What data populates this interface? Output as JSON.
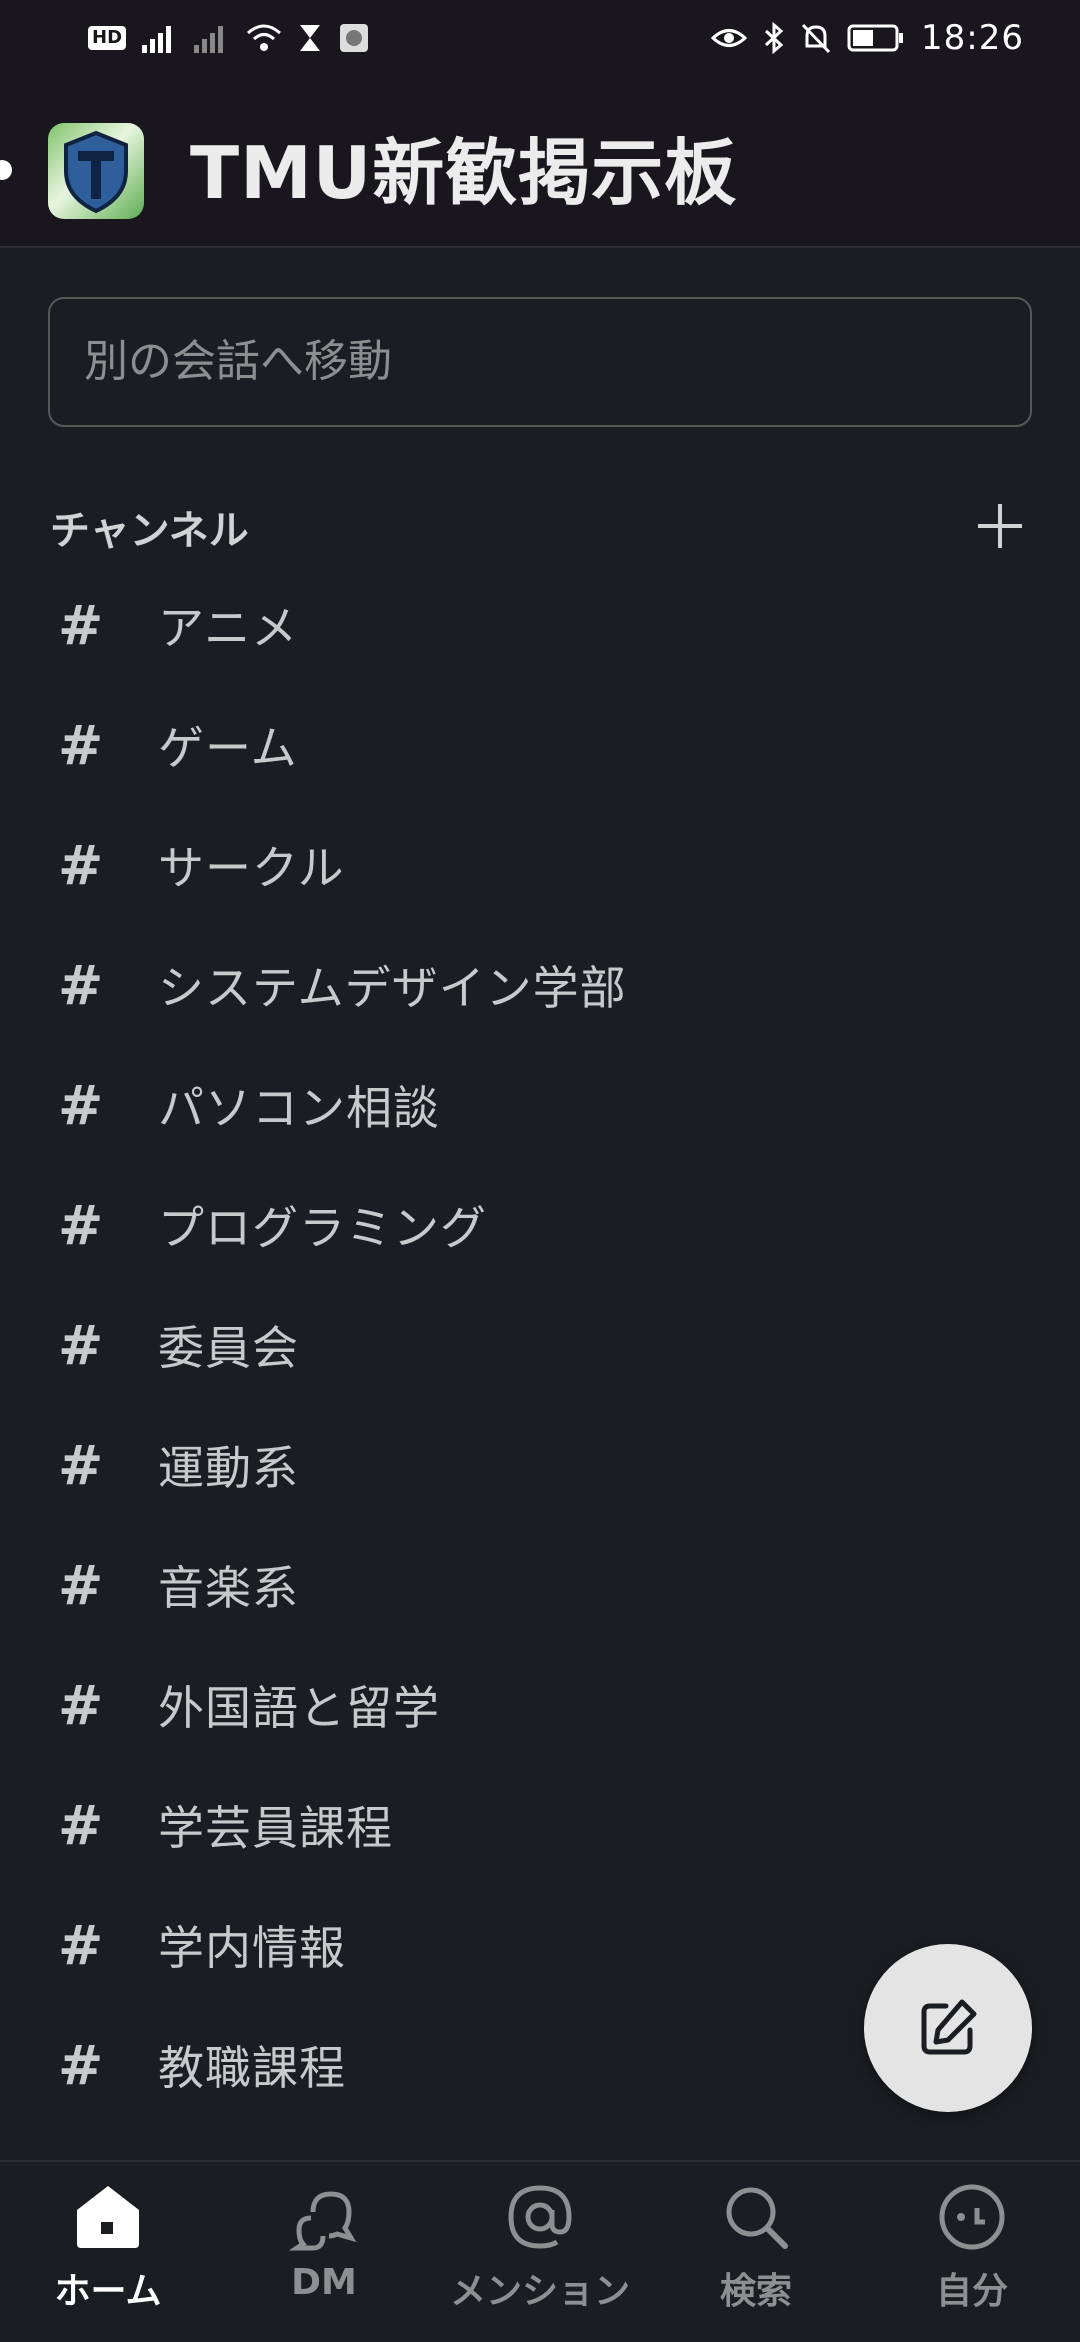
{
  "status_bar": {
    "time": "18:26",
    "hd_label": "HD"
  },
  "workspace": {
    "name": "TMU新歓掲示板"
  },
  "search": {
    "placeholder": "別の会話へ移動"
  },
  "channels_section": {
    "title": "チャンネル",
    "items": [
      {
        "name": "アニメ"
      },
      {
        "name": "ゲーム"
      },
      {
        "name": "サークル"
      },
      {
        "name": "システムデザイン学部"
      },
      {
        "name": "パソコン相談"
      },
      {
        "name": "プログラミング"
      },
      {
        "name": "委員会"
      },
      {
        "name": "運動系"
      },
      {
        "name": "音楽系"
      },
      {
        "name": "外国語と留学"
      },
      {
        "name": "学芸員課程"
      },
      {
        "name": "学内情報"
      },
      {
        "name": "教職課程"
      }
    ]
  },
  "bottom_nav": {
    "items": [
      {
        "label": "ホーム",
        "icon": "home-icon",
        "active": true
      },
      {
        "label": "DM",
        "icon": "dm-icon"
      },
      {
        "label": "メンション",
        "icon": "mention-icon"
      },
      {
        "label": "検索",
        "icon": "search-icon"
      },
      {
        "label": "自分",
        "icon": "profile-icon"
      }
    ]
  },
  "colors": {
    "background": "#1a1d21",
    "header": "#19171d",
    "text": "#d1d2d3",
    "fab": "#e4e4e4"
  }
}
